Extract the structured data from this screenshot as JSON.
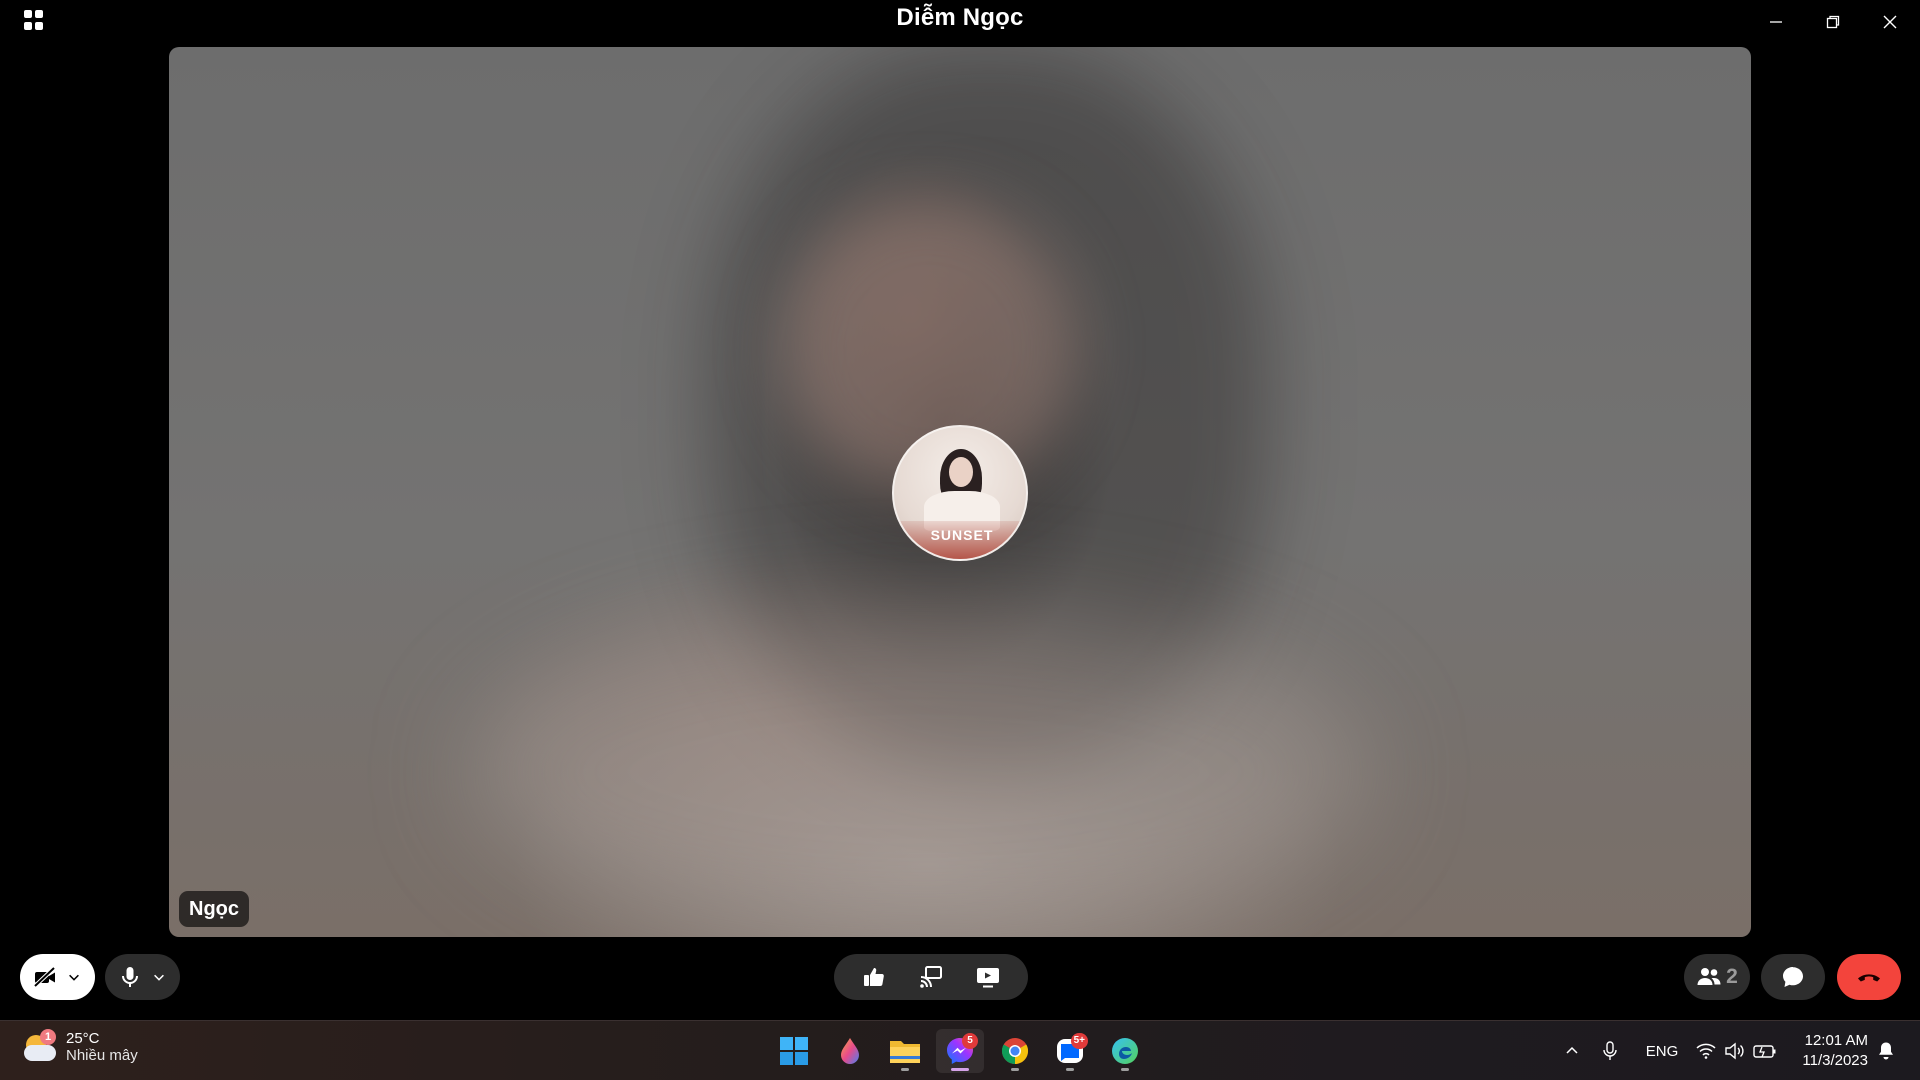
{
  "window": {
    "title": "Diễm Ngọc",
    "controls": [
      "minimize-icon",
      "restore-icon",
      "close-icon"
    ]
  },
  "stage": {
    "participant_name": "Ngọc",
    "avatar_brand": "SUNSET",
    "camera_state": "off"
  },
  "controls": {
    "camera": {
      "icon": "video-off-icon",
      "has_dropdown": true
    },
    "microphone": {
      "icon": "microphone-icon",
      "has_dropdown": true
    },
    "center": [
      "thumbs-up-icon",
      "cast-screen-icon",
      "share-screen-icon"
    ],
    "participants": {
      "icon": "people-icon",
      "count": "2"
    },
    "chat": {
      "icon": "chat-bubble-icon"
    },
    "end_call": {
      "icon": "hang-up-icon",
      "color": "#f3443c"
    }
  },
  "taskbar": {
    "weather": {
      "temp": "25°C",
      "condition": "Nhiều mây",
      "badge": "1"
    },
    "apps": [
      {
        "name": "start",
        "icon": "windows-logo-icon"
      },
      {
        "name": "paint",
        "icon": "paint-drop-icon"
      },
      {
        "name": "file-explorer",
        "icon": "folder-icon"
      },
      {
        "name": "messenger",
        "icon": "messenger-icon",
        "badge": "5",
        "active": true
      },
      {
        "name": "chrome",
        "icon": "chrome-icon"
      },
      {
        "name": "zalo",
        "icon": "zalo-icon",
        "badge": "5+"
      },
      {
        "name": "edge",
        "icon": "edge-icon"
      }
    ],
    "tray": {
      "language": "ENG",
      "time": "12:01 AM",
      "date": "11/3/2023"
    }
  },
  "colors": {
    "accent_end_call": "#f3443c",
    "pill_bg": "#2d2d2d",
    "badge_red": "#e03a3a"
  }
}
